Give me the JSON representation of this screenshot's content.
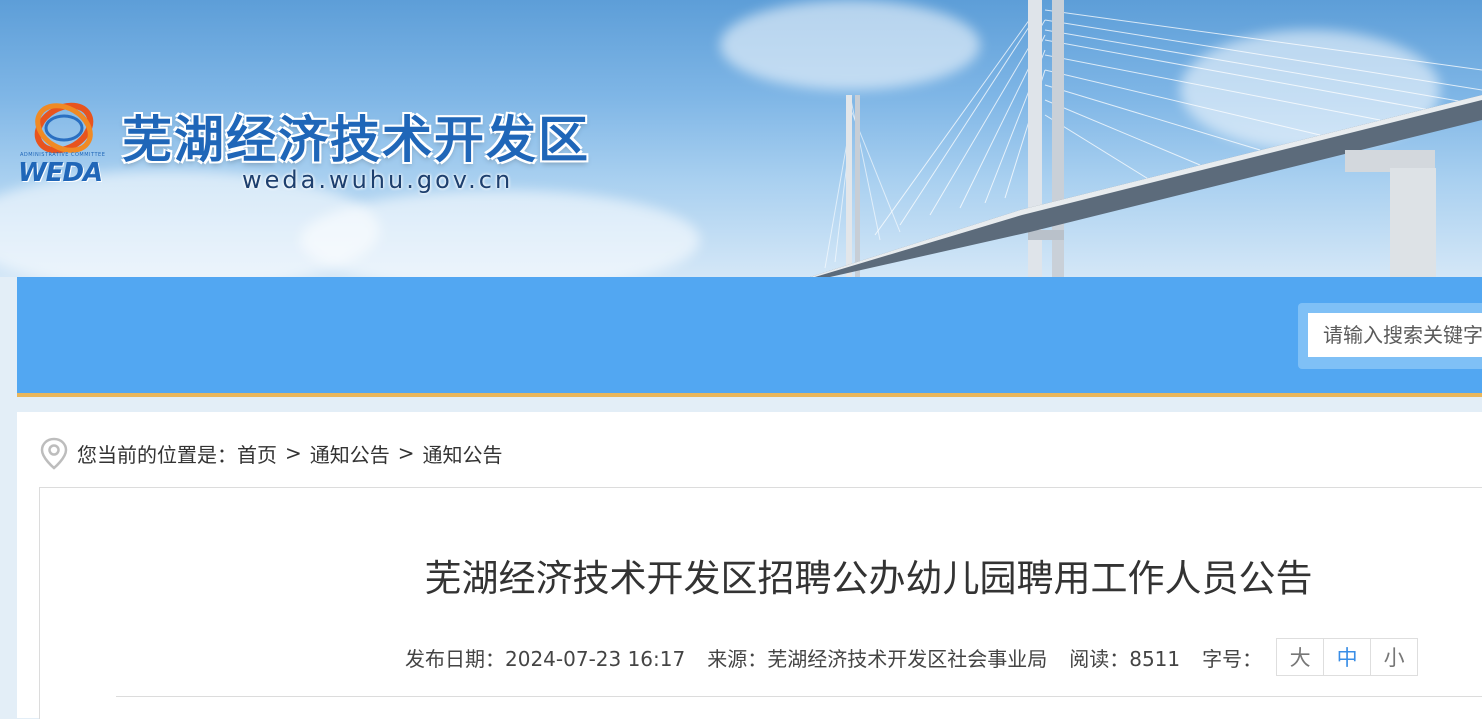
{
  "header": {
    "title": "芜湖经济技术开发区",
    "url": "weda.wuhu.gov.cn",
    "logo_caption": "ADMINISTRATIVE COMMITTEE",
    "logo_word": "WEDA",
    "logo_icon": "weda-logo-icon",
    "background": "bridge-sky-banner"
  },
  "search": {
    "placeholder": "请输入搜索关键字"
  },
  "breadcrumb": {
    "prefix": "您当前的位置是：",
    "items": [
      "首页",
      "通知公告",
      "通知公告"
    ],
    "separator": ">",
    "icon": "location-pin-icon"
  },
  "article": {
    "title": "芜湖经济技术开发区招聘公办幼儿园聘用工作人员公告",
    "publish_date": "发布日期：2024-07-23 16:17",
    "source": "来源：芜湖经济技术开发区社会事业局",
    "views": "阅读：8511",
    "font_size_label": "字号：",
    "font_sizes": [
      "大",
      "中",
      "小"
    ],
    "active_font_size": "中"
  },
  "colors": {
    "nav_blue": "#52a7f2",
    "nav_border": "#e9b65b",
    "title_blue": "#1f66b8",
    "page_bg": "#e3eef7",
    "active_font": "#3a8ee6"
  }
}
